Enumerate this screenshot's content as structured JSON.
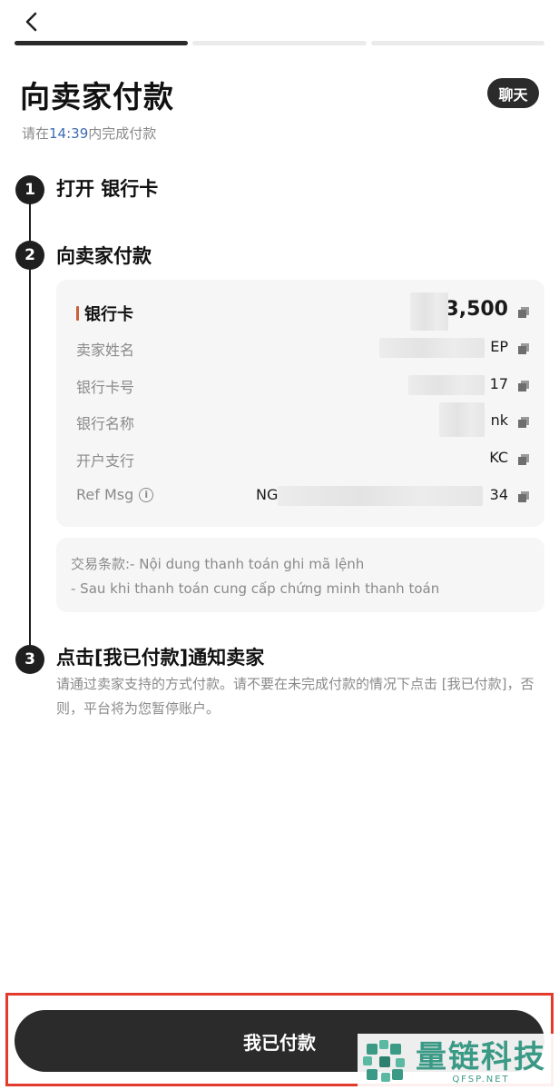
{
  "header": {
    "back_icon": "chevron-left-icon",
    "progress_total": 3,
    "progress_current": 1,
    "title": "向卖家付款",
    "chat_label": "聊天",
    "timer_prefix": "请在",
    "timer_time": "14:39",
    "timer_suffix": "内完成付款"
  },
  "steps": [
    {
      "number": "1",
      "title": "打开 银行卡"
    },
    {
      "number": "2",
      "title": "向卖家付款"
    },
    {
      "number": "3",
      "title": "点击[我已付款]通知卖家",
      "description": "请通过卖家支持的方式付款。请不要在未完成付款的情况下点击 [我已付款]，否则，平台将为您暂停账户。"
    }
  ],
  "payment_details": {
    "rows": [
      {
        "label": "银行卡",
        "value": "₫ 3,500"
      },
      {
        "label": "卖家姓名",
        "value": "EP"
      },
      {
        "label": "银行卡号",
        "value": "17"
      },
      {
        "label": "银行名称",
        "value": "nk"
      },
      {
        "label": "开户支行",
        "value": "KC"
      },
      {
        "label": "Ref Msg",
        "value_prefix": "NG",
        "value": "34"
      }
    ],
    "copy_icon": "copy-icon",
    "info_icon": "info-icon"
  },
  "terms": {
    "line1": "交易条款:- Nội dung thanh toán ghi mã lệnh",
    "line2": "- Sau khi thanh toán cung cấp chứng minh thanh toán"
  },
  "footer": {
    "paid_button_label": "我已付款"
  },
  "watermark": {
    "text_cn": "量链科技",
    "text_en": "QFSP.NET"
  },
  "colors": {
    "accent_dark": "#2b2b2b",
    "timer_blue": "#3d6cb3",
    "highlight_red": "#e23a2b",
    "watermark_green": "#3a9a86"
  }
}
